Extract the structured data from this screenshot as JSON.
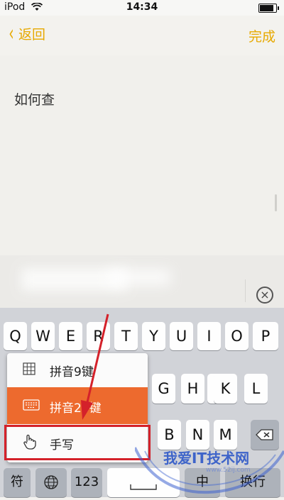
{
  "status_bar": {
    "carrier": "iPod",
    "time": "14:34"
  },
  "navbar": {
    "back_label": "返回",
    "done_label": "完成"
  },
  "note": {
    "text": "如何查"
  },
  "keyboard": {
    "row1": [
      "Q",
      "W",
      "E",
      "R",
      "T",
      "Y",
      "U",
      "I",
      "O",
      "P"
    ],
    "row2_visible": [
      "G",
      "H",
      "J",
      "K",
      "L"
    ],
    "row3_visible": [
      "B",
      "N",
      "M"
    ],
    "bottom": {
      "symbol_label": "符",
      "num_label": "123",
      "lang_label": "中",
      "return_label": "换行"
    }
  },
  "input_menu": {
    "items": [
      {
        "label": "拼音9键",
        "icon": "grid-keypad-icon"
      },
      {
        "label": "拼音26键",
        "icon": "keyboard-icon",
        "selected": true
      },
      {
        "label": "手写",
        "icon": "hand-pointer-icon"
      }
    ]
  },
  "annotation": {
    "highlight_color": "#d4212a",
    "arrow_color": "#d4212a"
  },
  "watermark": {
    "text": "我爱IT技术网",
    "url": "www.52ij.com"
  },
  "colors": {
    "accent": "#e7a900",
    "selected_item": "#ed6a2e"
  }
}
